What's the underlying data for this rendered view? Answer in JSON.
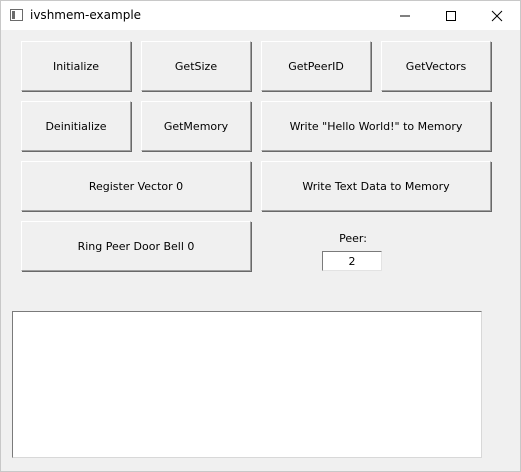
{
  "window": {
    "title": "ivshmem-example",
    "icon": "app-window-icon",
    "controls": {
      "minimize_icon": "minimize-icon",
      "maximize_icon": "maximize-icon",
      "close_icon": "close-icon"
    }
  },
  "buttons": {
    "initialize": "Initialize",
    "get_size": "GetSize",
    "get_peer_id": "GetPeerID",
    "get_vectors": "GetVectors",
    "deinitialize": "Deinitialize",
    "get_memory": "GetMemory",
    "write_hello": "Write \"Hello World!\" to Memory",
    "register_vector": "Register Vector 0",
    "write_text": "Write Text Data to Memory",
    "ring_peer": "Ring Peer Door Bell 0"
  },
  "peer": {
    "label": "Peer:",
    "value": "2"
  },
  "output": {
    "text": ""
  }
}
